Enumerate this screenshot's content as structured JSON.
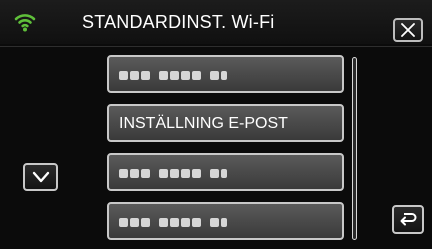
{
  "header": {
    "title": "STANDARDINST. Wi-Fi",
    "wifi_icon": "wifi-signal-icon",
    "close_icon": "close-x-icon",
    "accent_color": "#5fbf3a"
  },
  "menu": {
    "items": [
      {
        "label": "",
        "obscured": true
      },
      {
        "label": "INSTÄLLNING E-POST",
        "obscured": false
      },
      {
        "label": "",
        "obscured": true
      },
      {
        "label": "",
        "obscured": true
      }
    ]
  },
  "navigation": {
    "scroll_down_icon": "chevron-down-icon",
    "back_icon": "return-arrow-icon"
  }
}
